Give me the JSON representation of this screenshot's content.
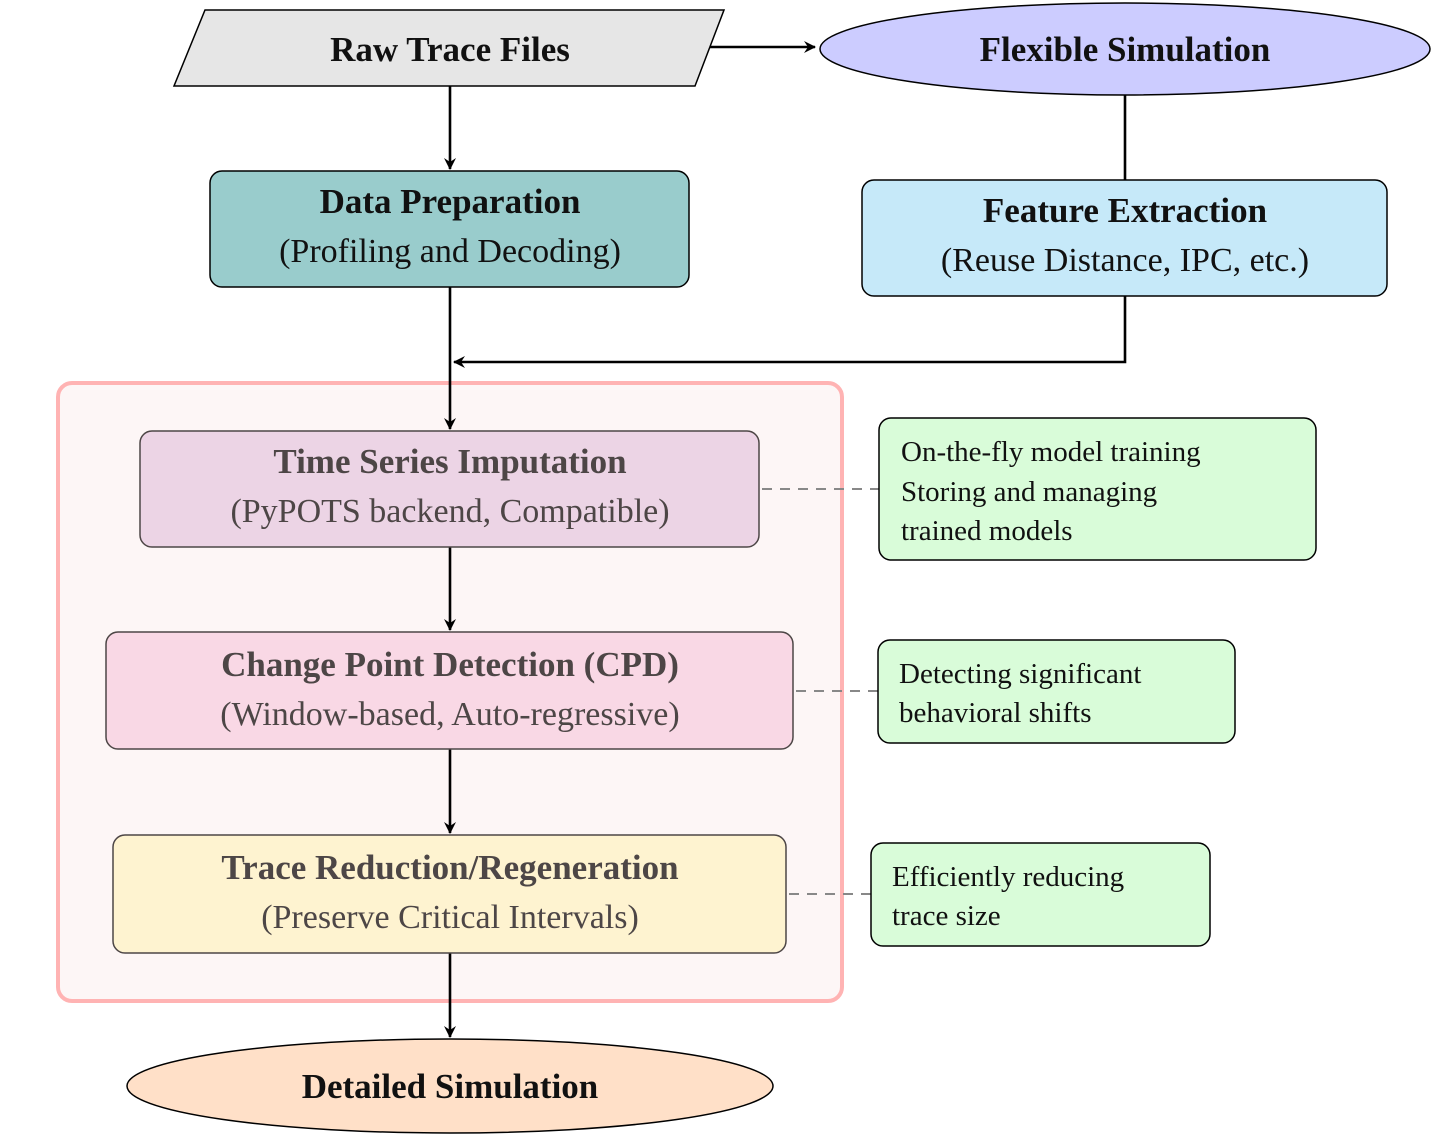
{
  "nodes": {
    "raw": {
      "title": "Raw Trace Files",
      "color": "#e6e6e6"
    },
    "flex": {
      "title": "Flexible Simulation",
      "color": "#ccccff"
    },
    "prep": {
      "title": "Data Preparation",
      "subtitle": "(Profiling and Decoding)",
      "color": "#99cccc"
    },
    "feat": {
      "title": "Feature Extraction",
      "subtitle": "(Reuse Distance, IPC, etc.)",
      "color": "#c6e9f9"
    },
    "tsi": {
      "title": "Time Series Imputation",
      "subtitle": "(PyPOTS backend, Compatible)",
      "color": "#ecd4e5"
    },
    "cpd": {
      "title": "Change Point Detection (CPD)",
      "subtitle": "(Window-based, Auto-regressive)",
      "color": "#f9d8e5"
    },
    "trr": {
      "title": "Trace Reduction/Regeneration",
      "subtitle": "(Preserve Critical Intervals)",
      "color": "#fef3d0"
    },
    "detail": {
      "title": "Detailed Simulation",
      "color": "#ffe0c8"
    }
  },
  "notes": [
    {
      "lines": [
        "On-the-fly model training",
        "Storing and managing",
        "trained models"
      ]
    },
    {
      "lines": [
        "Detecting significant",
        "behavioral shifts"
      ]
    },
    {
      "lines": [
        "Efficiently reducing",
        "trace size"
      ]
    }
  ],
  "colors": {
    "note": "#d9fcd9",
    "group_border": "#ffb3b3",
    "group_fill": "#fdf6f6"
  }
}
